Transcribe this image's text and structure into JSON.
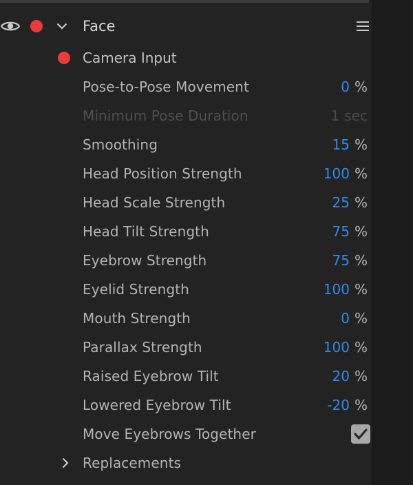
{
  "layer": {
    "title": "Face",
    "visible_icon": "eye-icon",
    "record_color": "#ec3b3b",
    "expanded_icon": "chevron-down-icon",
    "menu_icon": "hamburger-menu-icon"
  },
  "camera_input": {
    "label": "Camera Input",
    "armed": true
  },
  "params": [
    {
      "label": "Pose-to-Pose Movement",
      "value": "0",
      "unit": "%",
      "enabled": true
    },
    {
      "label": "Minimum Pose Duration",
      "value": "1",
      "unit": "sec",
      "enabled": false
    },
    {
      "label": "Smoothing",
      "value": "15",
      "unit": "%",
      "enabled": true
    },
    {
      "label": "Head Position Strength",
      "value": "100",
      "unit": "%",
      "enabled": true
    },
    {
      "label": "Head Scale Strength",
      "value": "25",
      "unit": "%",
      "enabled": true
    },
    {
      "label": "Head Tilt Strength",
      "value": "75",
      "unit": "%",
      "enabled": true
    },
    {
      "label": "Eyebrow Strength",
      "value": "75",
      "unit": "%",
      "enabled": true
    },
    {
      "label": "Eyelid Strength",
      "value": "100",
      "unit": "%",
      "enabled": true
    },
    {
      "label": "Mouth Strength",
      "value": "0",
      "unit": "%",
      "enabled": true
    },
    {
      "label": "Parallax Strength",
      "value": "100",
      "unit": "%",
      "enabled": true
    },
    {
      "label": "Raised Eyebrow Tilt",
      "value": "20",
      "unit": "%",
      "enabled": true
    },
    {
      "label": "Lowered Eyebrow Tilt",
      "value": "-20",
      "unit": "%",
      "enabled": true
    }
  ],
  "move_eyebrows_together": {
    "label": "Move Eyebrows Together",
    "checked": true
  },
  "replacements": {
    "label": "Replacements",
    "expanded": false,
    "icon": "chevron-right-icon"
  },
  "colors": {
    "background": "#232323",
    "value_blue": "#2d8ceb",
    "label_gray": "#b4b4b4",
    "disabled_gray": "#505050",
    "record_red": "#ec3b3b"
  }
}
